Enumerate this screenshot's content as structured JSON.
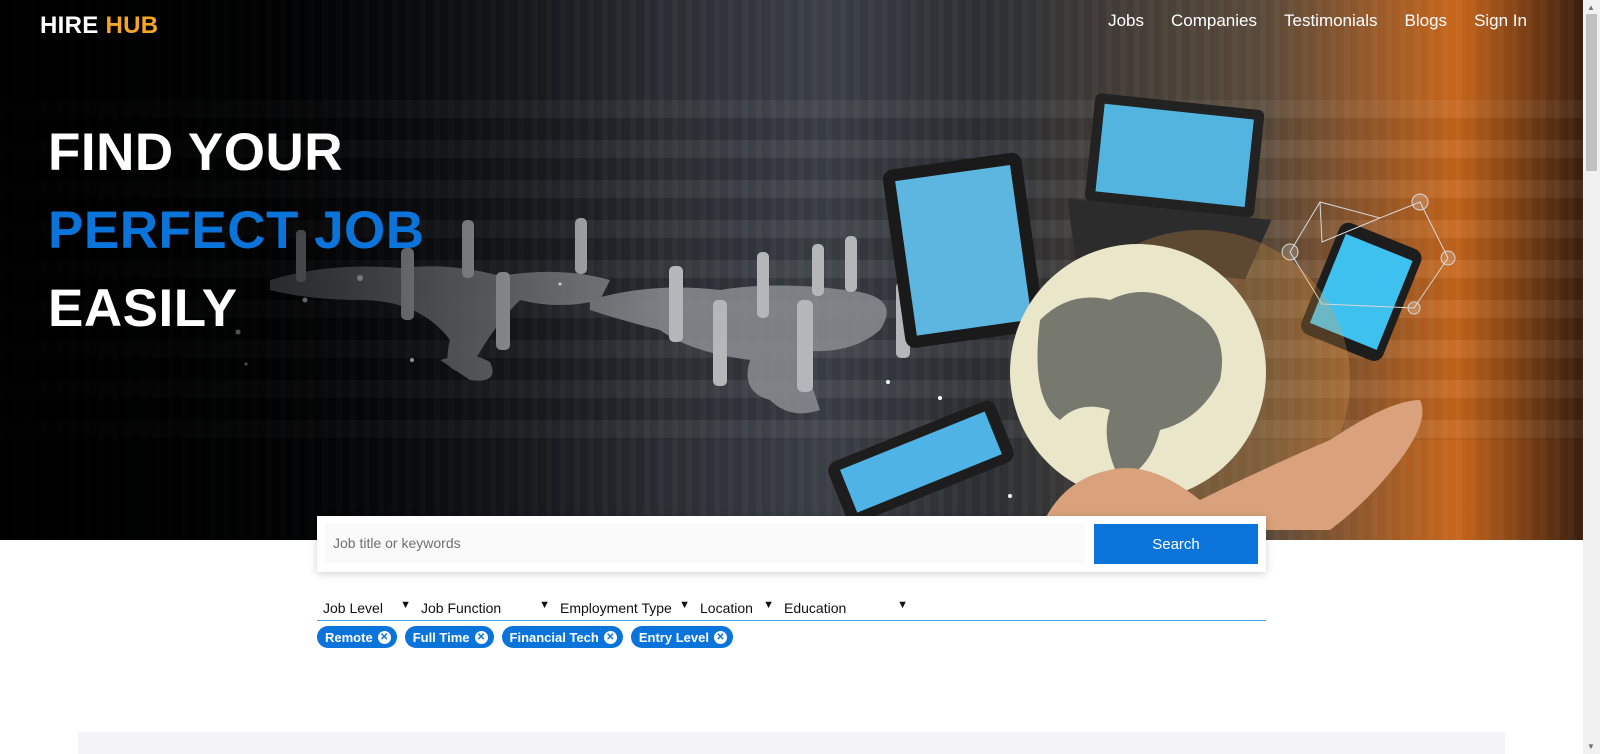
{
  "brand": {
    "name": "HIRE",
    "accent": "HUB"
  },
  "nav": [
    {
      "label": "Jobs"
    },
    {
      "label": "Companies"
    },
    {
      "label": "Testimonials"
    },
    {
      "label": "Blogs"
    },
    {
      "label": "Sign In"
    }
  ],
  "hero": {
    "line1": "FIND YOUR",
    "line2": "PERFECT JOB",
    "line3": "EASILY"
  },
  "search": {
    "placeholder": "Job title or keywords",
    "button_label": "Search"
  },
  "filters": [
    {
      "label": "Job Level"
    },
    {
      "label": "Job Function"
    },
    {
      "label": "Employment Type"
    },
    {
      "label": "Location"
    },
    {
      "label": "Education"
    }
  ],
  "chips": [
    {
      "label": "Remote"
    },
    {
      "label": "Full Time"
    },
    {
      "label": "Financial Tech"
    },
    {
      "label": "Entry Level"
    }
  ],
  "icons": {
    "chip_remove": "close-circle-icon",
    "filter_caret": "chevron-down-icon"
  },
  "colors": {
    "accent_blue": "#0a74da",
    "brand_orange": "#f5a623"
  }
}
